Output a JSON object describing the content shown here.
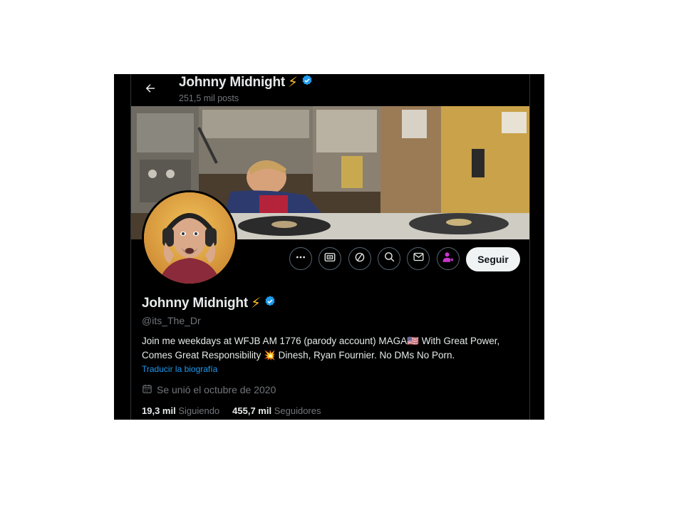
{
  "colors": {
    "background": "#000000",
    "text_primary": "#e7e9ea",
    "text_secondary": "#71767b",
    "link": "#1d9bf0",
    "verified": "#1d9bf0",
    "subscribe_accent": "#c936cc"
  },
  "header": {
    "back_icon": "arrow-left-icon",
    "name": "Johnny Midnight",
    "name_emoji": "⚡",
    "posts_count": "251,5 mil posts"
  },
  "actions": {
    "icons": [
      "more-icon",
      "grok-icon",
      "unfollow-cycle-icon",
      "search-icon",
      "mail-icon",
      "subscribe-icon"
    ],
    "follow_label": "Seguir"
  },
  "profile": {
    "display_name": "Johnny Midnight",
    "name_emoji": "⚡",
    "handle": "@its_The_Dr",
    "bio_line1": "Join me weekdays at WFJB AM 1776 (parody account) MAGA🇺🇸 With Great Power,",
    "bio_line2": "Comes Great Responsibility 💥 Dinesh, Ryan Fournier. No DMs No Porn.",
    "translate_label": "Traducir la biografía",
    "joined_icon": "calendar-icon",
    "joined": "Se unió el octubre de 2020"
  },
  "stats": {
    "following_count": "19,3 mil",
    "following_label": "Siguiendo",
    "followers_count": "455,7 mil",
    "followers_label": "Seguidores"
  }
}
